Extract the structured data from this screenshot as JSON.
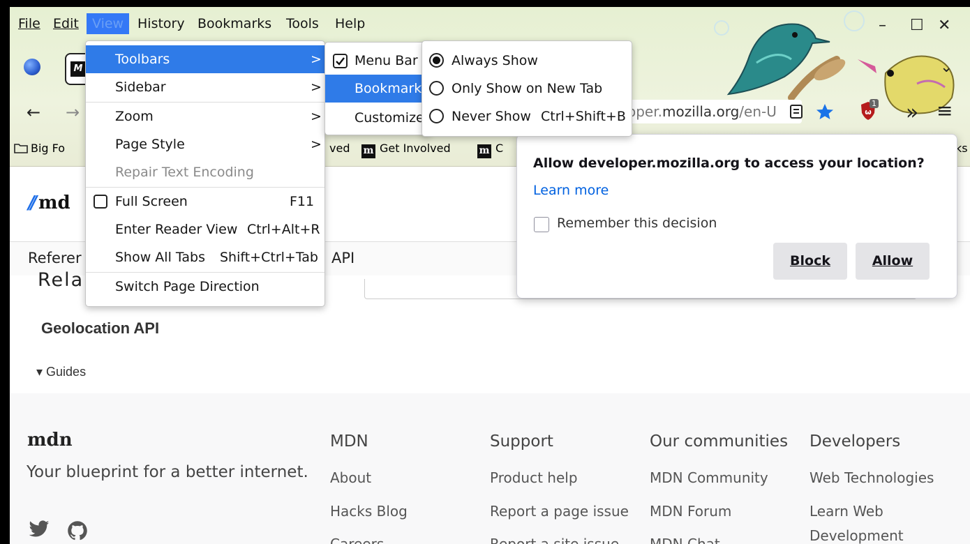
{
  "menubar": {
    "items": [
      "File",
      "Edit",
      "View",
      "History",
      "Bookmarks",
      "Tools",
      "Help"
    ],
    "active": "View"
  },
  "window_controls": {
    "minimize": "–",
    "maximize": "☐",
    "close": "✕",
    "chevron": "⌄"
  },
  "navbar": {
    "back": "←",
    "forward": "→",
    "url_prefix": "oper.",
    "url_host": "mozilla.org",
    "url_rest": "/en-U",
    "overflow": "»",
    "hamburger": "≡",
    "extension_badge": "1"
  },
  "bookmarks": {
    "items": [
      {
        "icon": "folder",
        "label": "Big Fo"
      },
      {
        "icon": "none",
        "label": "ved"
      },
      {
        "icon": "mdn",
        "label": "Get Involved"
      },
      {
        "icon": "mdn",
        "label": "C"
      },
      {
        "icon": "none",
        "label": "ks"
      }
    ]
  },
  "view_menu": {
    "items": [
      {
        "label": "Toolbars",
        "mnemonic": "T",
        "arrow": ">",
        "highlighted": true
      },
      {
        "label": "Sidebar",
        "arrow": ">"
      },
      {
        "label": "Zoom",
        "arrow": ">"
      },
      {
        "label": "Page Style",
        "arrow": ">"
      },
      {
        "label": "Repair Text Encoding",
        "disabled": true
      },
      {
        "label": "Full Screen",
        "shortcut": "F11",
        "checkbox": true
      },
      {
        "label": "Enter Reader View",
        "shortcut": "Ctrl+Alt+R"
      },
      {
        "label": "Show All Tabs",
        "shortcut": "Shift+Ctrl+Tab"
      },
      {
        "label": "Switch Page Direction"
      }
    ]
  },
  "toolbars_menu": {
    "items": [
      {
        "label": "Menu Bar",
        "checked": true
      },
      {
        "label": "Bookmark",
        "highlighted": true
      },
      {
        "label": "Customize"
      }
    ]
  },
  "bookmarks_toolbar_menu": {
    "items": [
      {
        "label": "Always Show",
        "selected": true
      },
      {
        "label": "Only Show on New Tab"
      },
      {
        "label": "Never Show",
        "shortcut": "Ctrl+Shift+B"
      }
    ]
  },
  "permission_popup": {
    "title": "Allow developer.mozilla.org to access your location?",
    "learn_more": "Learn more",
    "remember": "Remember this decision",
    "block": "Block",
    "allow": "Allow",
    "link_color": "#0061e0"
  },
  "page": {
    "logo_text": "md",
    "crumb_left": "Referer",
    "crumb_api": "API",
    "related": "Rela",
    "geolocation": "Geolocation API",
    "guides": "▾ Guides"
  },
  "footer": {
    "logo": "mdn",
    "tagline": "Your blueprint for a better internet.",
    "columns": [
      {
        "heading": "MDN",
        "links": [
          "About",
          "Hacks Blog",
          "Careers"
        ]
      },
      {
        "heading": "Support",
        "links": [
          "Product help",
          "Report a page issue",
          "Report a site issue"
        ]
      },
      {
        "heading": "Our communities",
        "links": [
          "MDN Community",
          "MDN Forum",
          "MDN Chat"
        ]
      },
      {
        "heading": "Developers",
        "links": [
          "Web Technologies",
          "Learn Web",
          "Development"
        ]
      }
    ]
  },
  "colors": {
    "accent": "#2f7be8",
    "mdn_blue": "#1d6ee8",
    "star": "#1a73e8"
  }
}
